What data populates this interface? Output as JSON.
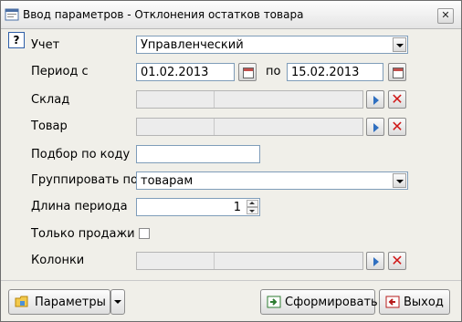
{
  "window": {
    "title": "Ввод параметров - Отклонения остатков товара",
    "close_symbol": "✕"
  },
  "help_symbol": "?",
  "form": {
    "uchet": {
      "label": "Учет",
      "value": "Управленческий"
    },
    "period": {
      "label": "Период с",
      "from": "01.02.2013",
      "to_label": "по",
      "to": "15.02.2013"
    },
    "sklad": {
      "label": "Склад",
      "value": ""
    },
    "tovar": {
      "label": "Товар",
      "value": ""
    },
    "podbor": {
      "label": "Подбор по коду",
      "value": ""
    },
    "group": {
      "label": "Группировать по",
      "value": "товарам"
    },
    "dlina": {
      "label": "Длина периода",
      "value": "1"
    },
    "only_sales": {
      "label": "Только продажи",
      "checked": false
    },
    "kolonki": {
      "label": "Колонки",
      "value": ""
    }
  },
  "buttons": {
    "params": "Параметры",
    "generate": "Сформировать",
    "exit": "Выход",
    "clear_symbol": "✕"
  }
}
